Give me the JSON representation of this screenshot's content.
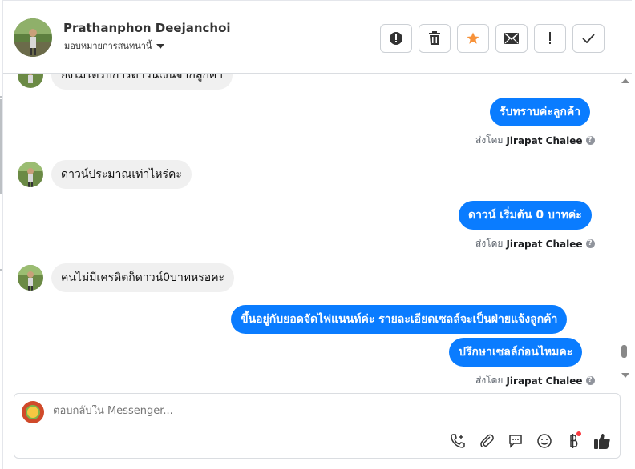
{
  "header": {
    "name": "Prathanphon Deejanchoi",
    "assign_label": "มอบหมายการสนทนานี้",
    "actions": [
      {
        "name": "report-button",
        "icon": "alert-circle-icon"
      },
      {
        "name": "delete-button",
        "icon": "trash-icon"
      },
      {
        "name": "star-button",
        "icon": "star-icon"
      },
      {
        "name": "mark-unread-button",
        "icon": "envelope-icon"
      },
      {
        "name": "follow-up-button",
        "icon": "exclamation-icon"
      },
      {
        "name": "mark-done-button",
        "icon": "check-icon"
      }
    ]
  },
  "messages": {
    "m0_cut": "ยังไม่ได้รับการดาวน์เงินจากลูกค้า",
    "m1": "รับทราบค่ะลูกค้า",
    "m2": "ดาวน์ประมาณเท่าไหร่คะ",
    "m3": "ดาวน์ เริ่มต้น 0 บาทค่ะ",
    "m4": "คนไม่มีเครดิตก็ดาวน์0บาทหรอคะ",
    "m5": "ขึ้นอยู่กับยอดจัดไฟแนนท์ค่ะ รายละเอียดเซลล์จะเป็นฝ่ายแจ้งลูกค้า",
    "m6": "ปรึกษาเซลล์ก่อนไหมคะ"
  },
  "sent_by": {
    "prefix": "ส่งโดย",
    "agent": "Jirapat Chalee",
    "help": "?"
  },
  "composer": {
    "placeholder": "ตอบกลับใน Messenger..."
  },
  "colors": {
    "outgoing_bubble": "#0a7cff",
    "incoming_bubble": "#f0f0f0",
    "star": "#f7923a"
  }
}
